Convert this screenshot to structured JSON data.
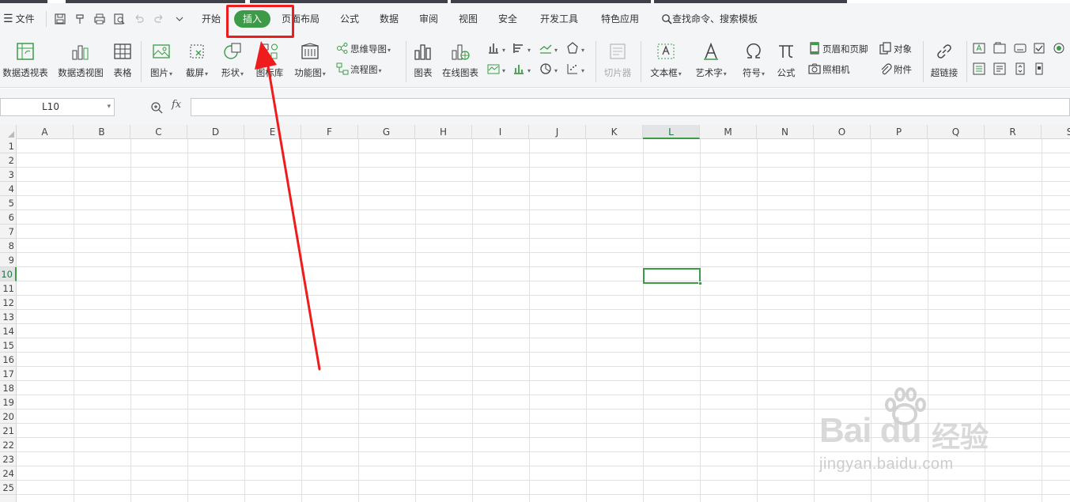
{
  "menubar": {
    "file": "文件",
    "tabs": [
      "开始",
      "插入",
      "页面布局",
      "公式",
      "数据",
      "审阅",
      "视图",
      "安全",
      "开发工具",
      "特色应用"
    ],
    "active_tab": "插入",
    "search": "查找命令、搜索模板"
  },
  "ribbon": {
    "pivot_table": "数据透视表",
    "pivot_chart": "数据透视图",
    "table": "表格",
    "picture": "图片",
    "screenshot": "截屏",
    "shape": "形状",
    "icon_lib": "图标库",
    "function_chart": "功能图",
    "mind_map": "思维导图",
    "flowchart": "流程图",
    "chart": "图表",
    "online_chart": "在线图表",
    "slicer": "切片器",
    "textbox": "文本框",
    "wordart": "艺术字",
    "symbol": "符号",
    "formula": "公式",
    "header_footer": "页眉和页脚",
    "object": "对象",
    "camera": "照相机",
    "attachment": "附件",
    "hyperlink": "超链接"
  },
  "formula_bar": {
    "name_box": "L10",
    "fx": "fx",
    "value": ""
  },
  "grid": {
    "columns": [
      "A",
      "B",
      "C",
      "D",
      "E",
      "F",
      "G",
      "H",
      "I",
      "J",
      "K",
      "L",
      "M",
      "N",
      "O",
      "P",
      "Q",
      "R",
      "S"
    ],
    "rows": [
      "1",
      "2",
      "3",
      "4",
      "5",
      "6",
      "7",
      "8",
      "9",
      "10",
      "11",
      "12",
      "13",
      "14",
      "15",
      "16",
      "17",
      "18",
      "19",
      "20",
      "21",
      "22",
      "23",
      "24",
      "25"
    ],
    "selected_column": "L",
    "selected_row": "10"
  },
  "watermark": {
    "logo": "Bai du",
    "cn": "经验",
    "url": "jingyan.baidu.com"
  },
  "colors": {
    "accent": "#3d9b47",
    "annotation": "#ee1c1c"
  }
}
